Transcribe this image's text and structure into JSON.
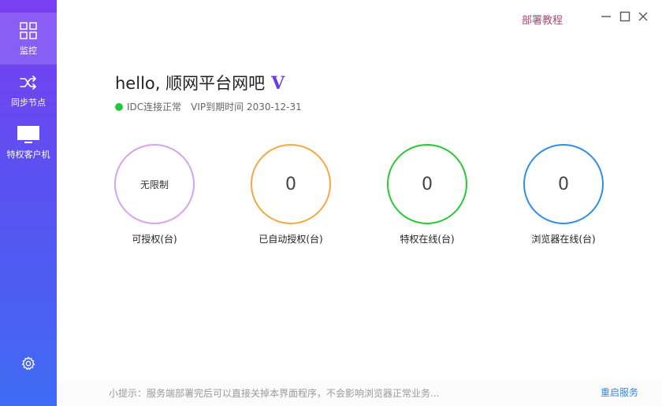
{
  "sidebar": {
    "items": [
      {
        "label": "监控",
        "icon": "grid-icon",
        "active": true
      },
      {
        "label": "同步节点",
        "icon": "shuffle-icon",
        "active": false
      },
      {
        "label": "特权客户机",
        "icon": "monitor-icon",
        "active": false
      }
    ],
    "settings_icon": "gear-icon"
  },
  "titlebar": {
    "tutorial_link": "部署教程",
    "controls": [
      "minimize-icon",
      "maximize-icon",
      "close-icon"
    ]
  },
  "header": {
    "greeting": "hello, 顺网平台网吧",
    "vip_mark": "V",
    "idc_status": "IDC连接正常",
    "vip_expiry": "VIP到期时间 2030-12-31"
  },
  "stats": [
    {
      "value": "无限制",
      "caption": "可授权(台)",
      "color": "#d7a3ec"
    },
    {
      "value": "0",
      "caption": "已自动授权(台)",
      "color": "#f5a742"
    },
    {
      "value": "0",
      "caption": "特权在线(台)",
      "color": "#24c933"
    },
    {
      "value": "0",
      "caption": "浏览器在线(台)",
      "color": "#2d8ee6"
    }
  ],
  "footer": {
    "tip": "小提示：服务端部署完后可以直接关掉本界面程序，不会影响浏览器正常业务...",
    "restart_link": "重启服务"
  },
  "colors": {
    "sidebar_top": "#7b3ff2",
    "sidebar_bottom": "#3f6cf5",
    "status_ok": "#21c83a",
    "link_blue": "#2b8be8",
    "tutorial": "#a64a6f"
  }
}
